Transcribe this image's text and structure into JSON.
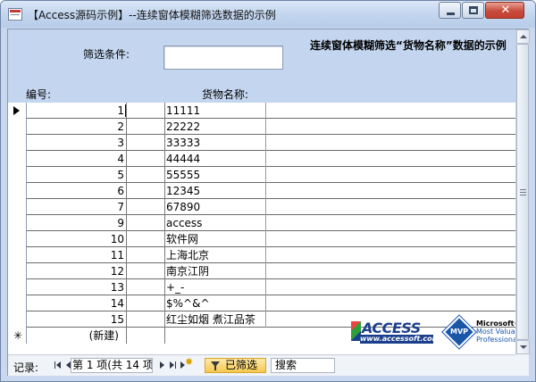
{
  "window": {
    "title": "【Access源码示例】--连续窗体模糊筛选数据的示例",
    "close_glyph": "✕"
  },
  "form": {
    "filter_label": "筛选条件:",
    "filter_value": "",
    "description": "连续窗体模糊筛选“货物名称”数据的示例",
    "col_id_label": "编号:",
    "col_name_label": "货物名称:"
  },
  "rows": [
    {
      "id": "1",
      "name": "11111"
    },
    {
      "id": "2",
      "name": "22222"
    },
    {
      "id": "3",
      "name": "33333"
    },
    {
      "id": "4",
      "name": "44444"
    },
    {
      "id": "5",
      "name": "55555"
    },
    {
      "id": "6",
      "name": "12345"
    },
    {
      "id": "7",
      "name": "67890"
    },
    {
      "id": "9",
      "name": "access"
    },
    {
      "id": "10",
      "name": "软件网"
    },
    {
      "id": "11",
      "name": "上海北京"
    },
    {
      "id": "12",
      "name": "南京江阴"
    },
    {
      "id": "13",
      "name": "+_-"
    },
    {
      "id": "14",
      "name": "$%^&^"
    },
    {
      "id": "15",
      "name": "红尘如烟 煮江品茶"
    }
  ],
  "new_row": {
    "marker": "✳",
    "id": "(新建)"
  },
  "logos": {
    "access_brand": "ACCESS",
    "access_url": "www.accessoft.com",
    "mvp_badge": "MVP",
    "mvp_line1": "Microsoft®",
    "mvp_line2": "Most Valuable",
    "mvp_line3": "Professional"
  },
  "navigation": {
    "label": "记录:",
    "position": "第 1 项(共 14 项",
    "filter_status": "已筛选",
    "search_placeholder": "搜索"
  }
}
